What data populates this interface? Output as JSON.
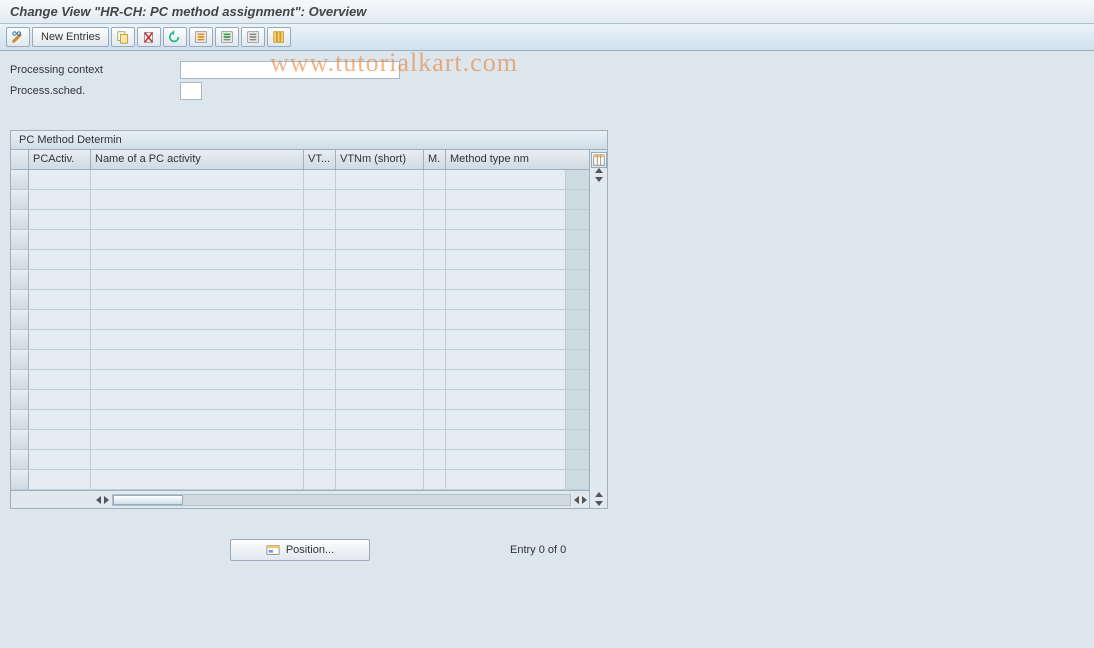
{
  "title": "Change View \"HR-CH: PC method assignment\": Overview",
  "toolbar": {
    "new_entries": "New Entries"
  },
  "form": {
    "processing_context_label": "Processing context",
    "process_sched_label": "Process.sched."
  },
  "panel": {
    "title": "PC Method Determin",
    "columns": {
      "pcactiv": "PCActiv.",
      "name": "Name of a PC activity",
      "vt": "VT...",
      "vtnm": "VTNm (short)",
      "m": "M.",
      "method_type": "Method type nm"
    }
  },
  "footer": {
    "position_label": "Position...",
    "entry_label": "Entry 0 of 0"
  },
  "watermark": "www.tutorialkart.com"
}
